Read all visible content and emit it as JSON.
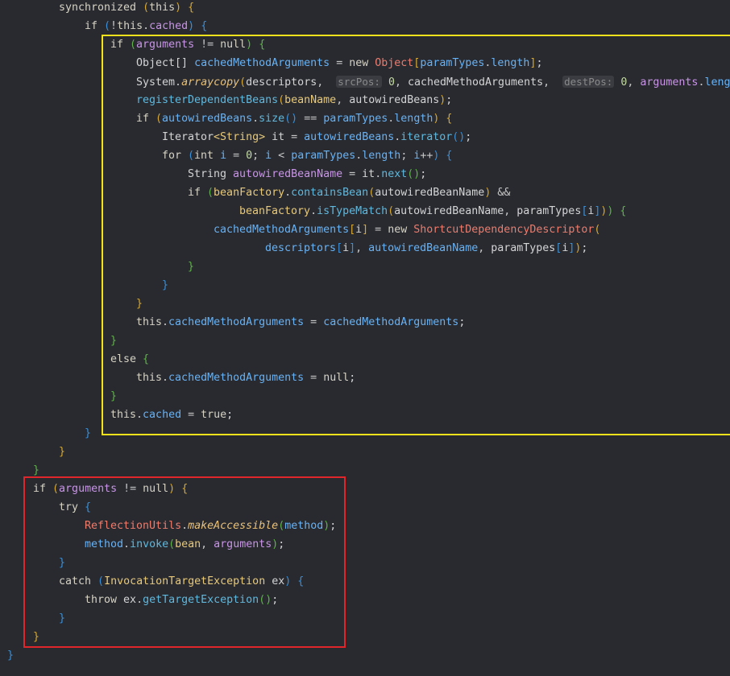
{
  "editor": {
    "lines": [
      [
        [
          "kw",
          "synchronized "
        ],
        [
          "br1",
          "("
        ],
        [
          "kw",
          "this"
        ],
        [
          "br1",
          ")"
        ],
        [
          "txt",
          " "
        ],
        [
          "br1",
          "{"
        ]
      ],
      [
        [
          "kw",
          "if "
        ],
        [
          "br2",
          "("
        ],
        [
          "op",
          "!"
        ],
        [
          "kw",
          "this"
        ],
        [
          "op",
          "."
        ],
        [
          "var",
          "cached"
        ],
        [
          "br2",
          ")"
        ],
        [
          "txt",
          " "
        ],
        [
          "br2",
          "{"
        ]
      ],
      [
        [
          "kw",
          "if "
        ],
        [
          "br3",
          "("
        ],
        [
          "var",
          "arguments"
        ],
        [
          "op",
          " != "
        ],
        [
          "kw",
          "null"
        ],
        [
          "br3",
          ")"
        ],
        [
          "txt",
          " "
        ],
        [
          "br3",
          "{"
        ]
      ],
      [
        [
          "txt",
          "Object[] "
        ],
        [
          "id",
          "cachedMethodArguments"
        ],
        [
          "op",
          " = "
        ],
        [
          "kw",
          "new "
        ],
        [
          "err",
          "Object"
        ],
        [
          "br1",
          "["
        ],
        [
          "id",
          "paramTypes"
        ],
        [
          "op",
          "."
        ],
        [
          "id",
          "length"
        ],
        [
          "br1",
          "]"
        ],
        [
          "txt",
          ";"
        ]
      ],
      [
        [
          "txt",
          "System"
        ],
        [
          "op",
          "."
        ],
        [
          "stat",
          "arraycopy"
        ],
        [
          "br1",
          "("
        ],
        [
          "txt",
          "descriptors"
        ],
        [
          "op",
          ",  "
        ],
        [
          "hint",
          "srcPos:"
        ],
        [
          "txt",
          " "
        ],
        [
          "num",
          "0"
        ],
        [
          "op",
          ", "
        ],
        [
          "txt",
          "cachedMethodArguments"
        ],
        [
          "op",
          ",  "
        ],
        [
          "hint",
          "destPos:"
        ],
        [
          "txt",
          " "
        ],
        [
          "num",
          "0"
        ],
        [
          "op",
          ", "
        ],
        [
          "var",
          "arguments"
        ],
        [
          "op",
          "."
        ],
        [
          "id",
          "length"
        ],
        [
          "br1",
          ")"
        ],
        [
          "txt",
          ";"
        ]
      ],
      [
        [
          "meth",
          "registerDependentBeans"
        ],
        [
          "br1",
          "("
        ],
        [
          "type",
          "beanName"
        ],
        [
          "op",
          ", "
        ],
        [
          "txt",
          "autowiredBeans"
        ],
        [
          "br1",
          ")"
        ],
        [
          "txt",
          ";"
        ]
      ],
      [
        [
          "kw",
          "if "
        ],
        [
          "br1",
          "("
        ],
        [
          "id",
          "autowiredBeans"
        ],
        [
          "op",
          "."
        ],
        [
          "meth",
          "size"
        ],
        [
          "br2",
          "()"
        ],
        [
          "op",
          " == "
        ],
        [
          "id",
          "paramTypes"
        ],
        [
          "op",
          "."
        ],
        [
          "id",
          "length"
        ],
        [
          "br1",
          ")"
        ],
        [
          "txt",
          " "
        ],
        [
          "br1",
          "{"
        ]
      ],
      [
        [
          "txt",
          "Iterator"
        ],
        [
          "type",
          "<String>"
        ],
        [
          "txt",
          " it "
        ],
        [
          "op",
          "= "
        ],
        [
          "id",
          "autowiredBeans"
        ],
        [
          "op",
          "."
        ],
        [
          "meth",
          "iterator"
        ],
        [
          "br2",
          "()"
        ],
        [
          "txt",
          ";"
        ]
      ],
      [
        [
          "kw",
          "for "
        ],
        [
          "br2",
          "("
        ],
        [
          "kw",
          "int "
        ],
        [
          "id",
          "i"
        ],
        [
          "op",
          " = "
        ],
        [
          "num",
          "0"
        ],
        [
          "op",
          "; "
        ],
        [
          "id",
          "i"
        ],
        [
          "op",
          " < "
        ],
        [
          "id",
          "paramTypes"
        ],
        [
          "op",
          "."
        ],
        [
          "id",
          "length"
        ],
        [
          "op",
          "; "
        ],
        [
          "id",
          "i"
        ],
        [
          "op",
          "++"
        ],
        [
          "br2",
          ")"
        ],
        [
          "txt",
          " "
        ],
        [
          "br2",
          "{"
        ]
      ],
      [
        [
          "txt",
          "String "
        ],
        [
          "var",
          "autowiredBeanName"
        ],
        [
          "op",
          " = "
        ],
        [
          "txt",
          "it"
        ],
        [
          "op",
          "."
        ],
        [
          "meth",
          "next"
        ],
        [
          "br3",
          "()"
        ],
        [
          "txt",
          ";"
        ]
      ],
      [
        [
          "kw",
          "if "
        ],
        [
          "br3",
          "("
        ],
        [
          "type",
          "beanFactory"
        ],
        [
          "op",
          "."
        ],
        [
          "meth",
          "containsBean"
        ],
        [
          "br1",
          "("
        ],
        [
          "txt",
          "autowiredBeanName"
        ],
        [
          "br1",
          ")"
        ],
        [
          "op",
          " &&"
        ]
      ],
      [
        [
          "type",
          "beanFactory"
        ],
        [
          "op",
          "."
        ],
        [
          "meth",
          "isTypeMatch"
        ],
        [
          "br1",
          "("
        ],
        [
          "txt",
          "autowiredBeanName"
        ],
        [
          "op",
          ", "
        ],
        [
          "txt",
          "paramTypes"
        ],
        [
          "br2",
          "["
        ],
        [
          "txt",
          "i"
        ],
        [
          "br2",
          "]"
        ],
        [
          "br1",
          ")"
        ],
        [
          "br3",
          ")"
        ],
        [
          "txt",
          " "
        ],
        [
          "br3",
          "{"
        ]
      ],
      [
        [
          "id",
          "cachedMethodArguments"
        ],
        [
          "br1",
          "["
        ],
        [
          "txt",
          "i"
        ],
        [
          "br1",
          "]"
        ],
        [
          "op",
          " = "
        ],
        [
          "kw",
          "new "
        ],
        [
          "err",
          "ShortcutDependencyDescriptor"
        ],
        [
          "br1",
          "("
        ]
      ],
      [
        [
          "id",
          "descriptors"
        ],
        [
          "br2",
          "["
        ],
        [
          "txt",
          "i"
        ],
        [
          "br2",
          "]"
        ],
        [
          "op",
          ", "
        ],
        [
          "id",
          "autowiredBeanName"
        ],
        [
          "op",
          ", "
        ],
        [
          "txt",
          "paramTypes"
        ],
        [
          "br2",
          "["
        ],
        [
          "txt",
          "i"
        ],
        [
          "br2",
          "]"
        ],
        [
          "br1",
          ")"
        ],
        [
          "txt",
          ";"
        ]
      ],
      [
        [
          "br3",
          "}"
        ]
      ],
      [
        [
          "br2",
          "}"
        ]
      ],
      [
        [
          "br1",
          "}"
        ]
      ],
      [
        [
          "kw",
          "this"
        ],
        [
          "op",
          "."
        ],
        [
          "id",
          "cachedMethodArguments"
        ],
        [
          "op",
          " = "
        ],
        [
          "id",
          "cachedMethodArguments"
        ],
        [
          "txt",
          ";"
        ]
      ],
      [
        [
          "br3",
          "}"
        ]
      ],
      [
        [
          "kw",
          "else "
        ],
        [
          "br3",
          "{"
        ]
      ],
      [
        [
          "kw",
          "this"
        ],
        [
          "op",
          "."
        ],
        [
          "id",
          "cachedMethodArguments"
        ],
        [
          "op",
          " = "
        ],
        [
          "kw",
          "null"
        ],
        [
          "txt",
          ";"
        ]
      ],
      [
        [
          "br3",
          "}"
        ]
      ],
      [
        [
          "kw",
          "this"
        ],
        [
          "op",
          "."
        ],
        [
          "id",
          "cached"
        ],
        [
          "op",
          " = "
        ],
        [
          "kw",
          "true"
        ],
        [
          "txt",
          ";"
        ]
      ],
      [
        [
          "br2",
          "}"
        ]
      ],
      [
        [
          "br1",
          "}"
        ]
      ],
      [
        [
          "br3",
          "}"
        ]
      ],
      [
        [
          "kw",
          "if "
        ],
        [
          "br1",
          "("
        ],
        [
          "var",
          "arguments"
        ],
        [
          "op",
          " != "
        ],
        [
          "kw",
          "null"
        ],
        [
          "br1",
          ")"
        ],
        [
          "txt",
          " "
        ],
        [
          "br1",
          "{"
        ]
      ],
      [
        [
          "kw",
          "try "
        ],
        [
          "br2",
          "{"
        ]
      ],
      [
        [
          "err",
          "ReflectionUtils"
        ],
        [
          "op",
          "."
        ],
        [
          "stat",
          "makeAccessible"
        ],
        [
          "br3",
          "("
        ],
        [
          "id",
          "method"
        ],
        [
          "br3",
          ")"
        ],
        [
          "txt",
          ";"
        ]
      ],
      [
        [
          "id",
          "method"
        ],
        [
          "op",
          "."
        ],
        [
          "meth",
          "invoke"
        ],
        [
          "br3",
          "("
        ],
        [
          "type",
          "bean"
        ],
        [
          "op",
          ", "
        ],
        [
          "var",
          "arguments"
        ],
        [
          "br3",
          ")"
        ],
        [
          "txt",
          ";"
        ]
      ],
      [
        [
          "br2",
          "}"
        ]
      ],
      [
        [
          "kw",
          "catch "
        ],
        [
          "br2",
          "("
        ],
        [
          "type",
          "InvocationTargetException"
        ],
        [
          "txt",
          " ex"
        ],
        [
          "br2",
          ")"
        ],
        [
          "txt",
          " "
        ],
        [
          "br2",
          "{"
        ]
      ],
      [
        [
          "kw",
          "throw "
        ],
        [
          "txt",
          "ex"
        ],
        [
          "op",
          "."
        ],
        [
          "meth",
          "getTargetException"
        ],
        [
          "br3",
          "()"
        ],
        [
          "txt",
          ";"
        ]
      ],
      [
        [
          "br2",
          "}"
        ]
      ],
      [
        [
          "br1",
          "}"
        ]
      ],
      [
        [
          "br2",
          "}"
        ]
      ]
    ]
  }
}
